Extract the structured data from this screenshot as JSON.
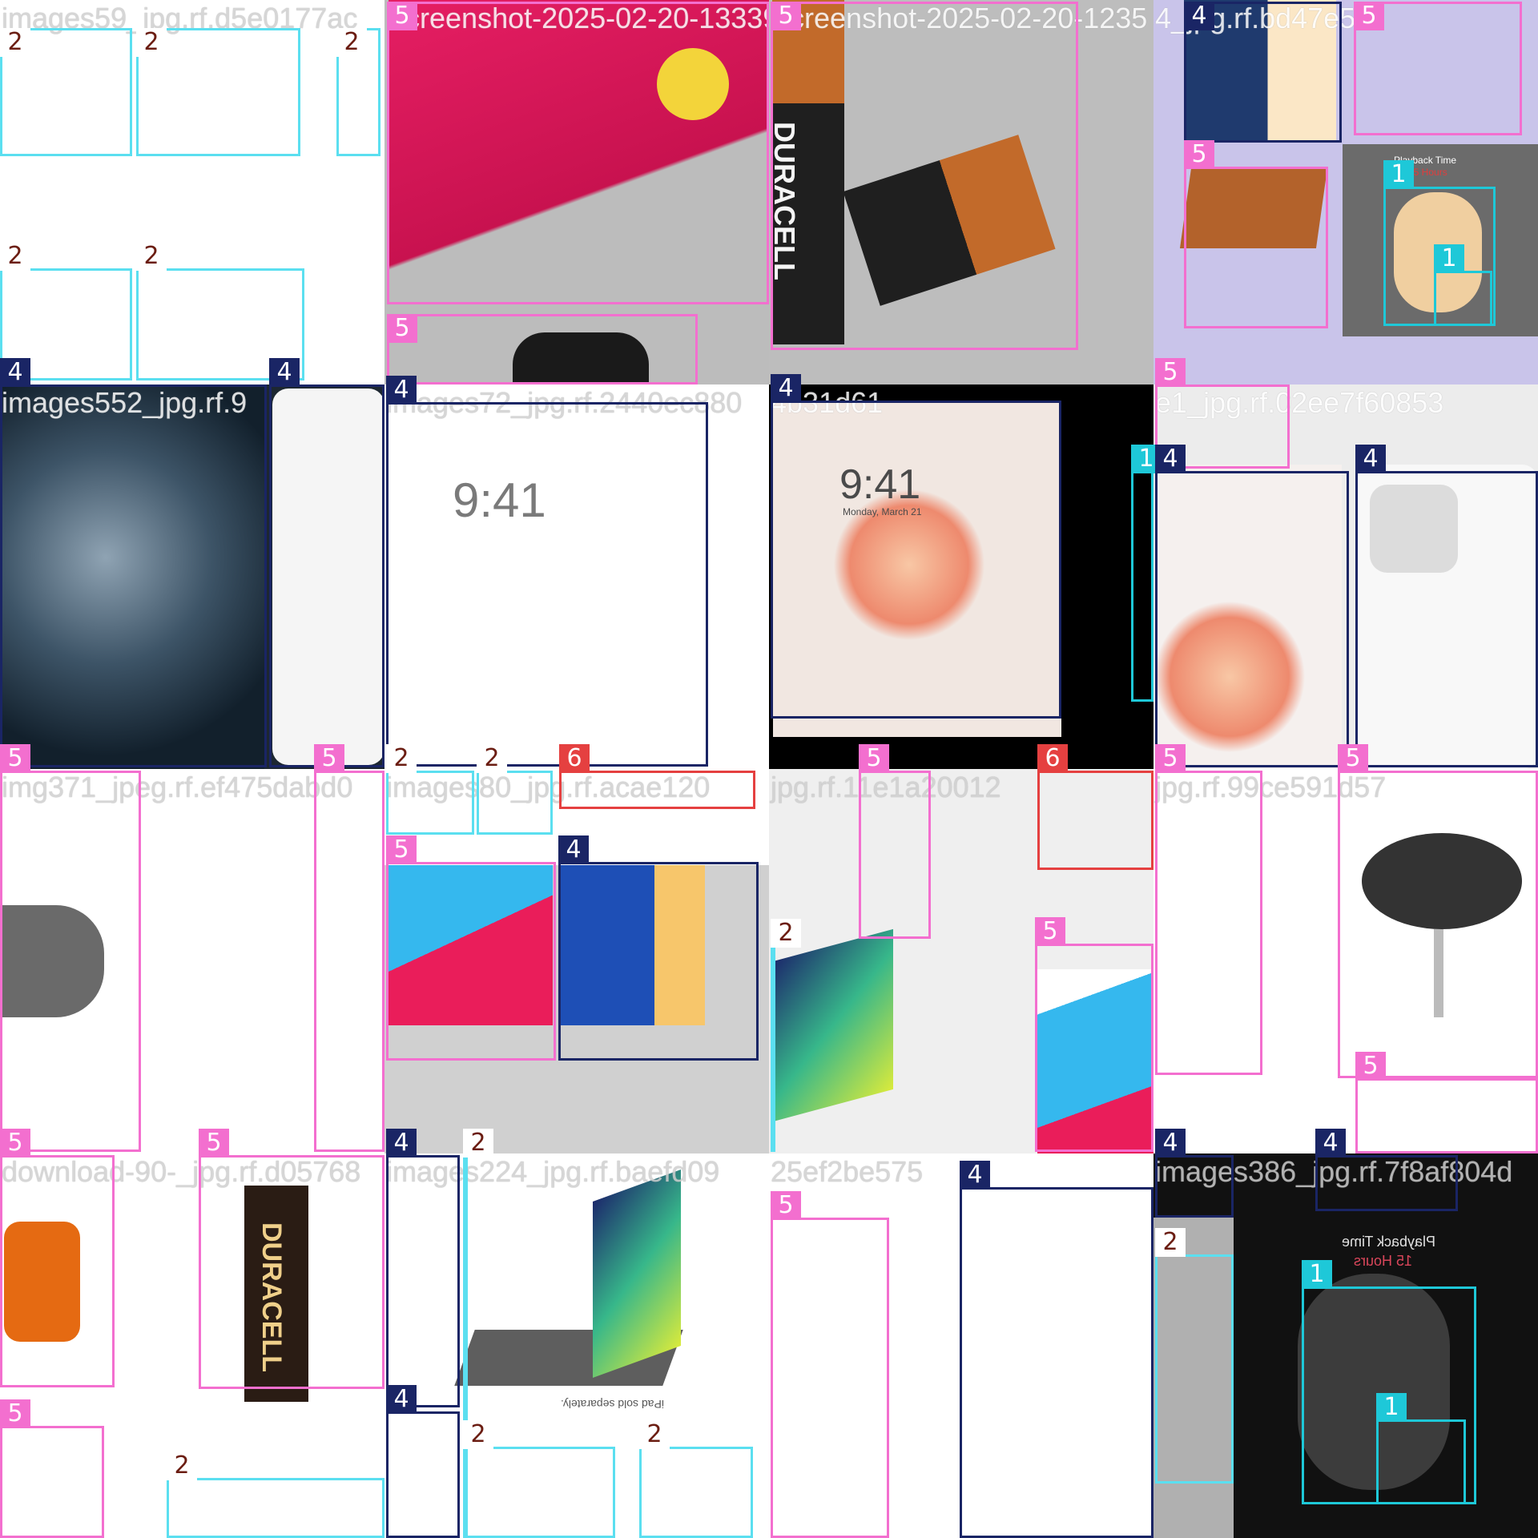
{
  "colors": {
    "class_1": "#1ec8d8",
    "class_2": "#5bdff0",
    "class_4": "#1a2565",
    "class_5": "#f36fcf",
    "class_6": "#e54040"
  },
  "tiles": [
    {
      "id": "r1c1",
      "title": "images59_jpg.rf.d5e0177ac",
      "bg": "#ffffff",
      "light": true
    },
    {
      "id": "r1c2",
      "title": "Screenshot-2025-02-20-13339",
      "bg": "#c23a63",
      "light": false
    },
    {
      "id": "r1c3",
      "title": "Screenshot-2025-02-20-1235",
      "bg": "#bdbdbd",
      "light": false
    },
    {
      "id": "r1c4",
      "title": "4_jpg.rf.bd47e50",
      "bg": "#c9c4ea",
      "light": false
    },
    {
      "id": "r2c1",
      "title": "images552_jpg.rf.9",
      "bg": "#1d2731",
      "light": false
    },
    {
      "id": "r2c2",
      "title": "images72_jpg.rf.2440ec880",
      "bg": "#ffffff",
      "light": true
    },
    {
      "id": "r2c3",
      "title": "4b31d61",
      "bg": "#e9e4df",
      "light": false
    },
    {
      "id": "r2c4",
      "title": "e1_jpg.rf.02ee7f60853",
      "bg": "#ececec",
      "light": false
    },
    {
      "id": "r3c1",
      "title": "img371_jpeg.rf.ef475dabd0",
      "bg": "#ffffff",
      "light": true
    },
    {
      "id": "r3c2",
      "title": "images80_jpg.rf.acae120",
      "bg": "#d0d0d0",
      "light": true
    },
    {
      "id": "r3c3",
      "title": "jpg.rf.11e1a20012",
      "bg": "#efefef",
      "light": true
    },
    {
      "id": "r3c4",
      "title": "jpg.rf.99ce591d57",
      "bg": "#ffffff",
      "light": true
    },
    {
      "id": "r4c1",
      "title": "download-90-_jpg.rf.d05768",
      "bg": "#ffffff",
      "light": true
    },
    {
      "id": "r4c2",
      "title": "images224_jpg.rf.baefd09",
      "bg": "#ffffff",
      "light": true
    },
    {
      "id": "r4c3",
      "title": "25ef2be575",
      "bg": "#ffffff",
      "light": true
    },
    {
      "id": "r4c4",
      "title": "images386_jpg.rf.7f8af804d",
      "bg": "#111111",
      "light": true
    }
  ],
  "boxes": [
    {
      "cls": "2"
    },
    {
      "cls": "2"
    },
    {
      "cls": "2"
    },
    {
      "cls": "2"
    },
    {
      "cls": "2"
    },
    {
      "cls": "5"
    },
    {
      "cls": "5"
    },
    {
      "cls": "5"
    },
    {
      "cls": "4"
    },
    {
      "cls": "5"
    },
    {
      "cls": "5"
    },
    {
      "cls": "1"
    },
    {
      "cls": "1"
    },
    {
      "cls": "4"
    },
    {
      "cls": "4"
    },
    {
      "cls": "4"
    },
    {
      "cls": "4"
    },
    {
      "cls": "1"
    },
    {
      "cls": "5"
    },
    {
      "cls": "4"
    },
    {
      "cls": "4"
    },
    {
      "cls": "5"
    },
    {
      "cls": "5"
    },
    {
      "cls": "2"
    },
    {
      "cls": "2"
    },
    {
      "cls": "6"
    },
    {
      "cls": "5"
    },
    {
      "cls": "4"
    },
    {
      "cls": "5"
    },
    {
      "cls": "6"
    },
    {
      "cls": "2"
    },
    {
      "cls": "5"
    },
    {
      "cls": "5"
    },
    {
      "cls": "5"
    },
    {
      "cls": "5"
    },
    {
      "cls": "5"
    },
    {
      "cls": "5"
    },
    {
      "cls": "5"
    },
    {
      "cls": "2"
    },
    {
      "cls": "4"
    },
    {
      "cls": "4"
    },
    {
      "cls": "2"
    },
    {
      "cls": "2"
    },
    {
      "cls": "2"
    },
    {
      "cls": "5"
    },
    {
      "cls": "4"
    },
    {
      "cls": "4"
    },
    {
      "cls": "4"
    },
    {
      "cls": "2"
    },
    {
      "cls": "1"
    },
    {
      "cls": "1"
    }
  ],
  "product_text": {
    "battery_brand": "DURACELL",
    "phone_time": "9:41",
    "phone_date": "Monday, March 21",
    "headphone_heading": "Playback Time",
    "headphone_hours": "15 Hours",
    "ipad_caption": "iPad sold separately."
  }
}
